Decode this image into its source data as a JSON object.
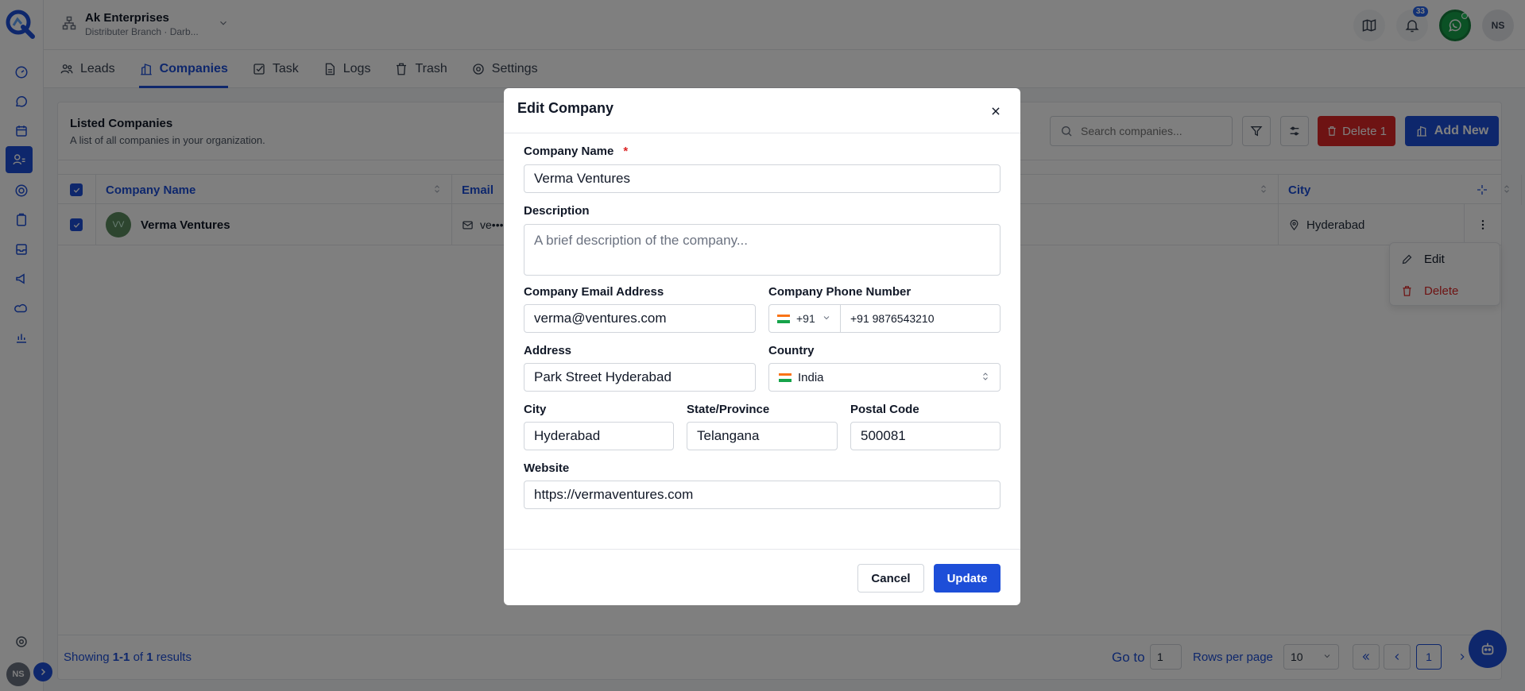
{
  "org": {
    "name": "Ak Enterprises",
    "sub": "Distributer Branch · Darb..."
  },
  "notifications": {
    "count": "33"
  },
  "user": {
    "initials": "NS"
  },
  "tabs": [
    {
      "label": "Leads",
      "icon": "users-icon"
    },
    {
      "label": "Companies",
      "icon": "building-icon"
    },
    {
      "label": "Task",
      "icon": "checkbox-icon"
    },
    {
      "label": "Logs",
      "icon": "file-icon"
    },
    {
      "label": "Trash",
      "icon": "trash-icon"
    },
    {
      "label": "Settings",
      "icon": "gear-icon"
    }
  ],
  "list": {
    "title": "Listed Companies",
    "subtitle": "A list of all companies in your organization.",
    "search_placeholder": "Search companies...",
    "delete_label": "Delete 1",
    "add_label": "Add New"
  },
  "table": {
    "columns": [
      "Company Name",
      "Email",
      "City"
    ],
    "rows": [
      {
        "initials": "VV",
        "name": "Verma Ventures",
        "email": "ve•••",
        "city": "Hyderabad"
      }
    ]
  },
  "row_menu": {
    "edit": "Edit",
    "delete": "Delete"
  },
  "footer": {
    "showing_prefix": "Showing ",
    "showing_range": "1-1",
    "showing_of": " of ",
    "showing_total": "1",
    "showing_suffix": " results",
    "goto_label": "Go to",
    "goto_value": "1",
    "rows_label": "Rows per page",
    "rows_value": "10",
    "page": "1"
  },
  "modal": {
    "title": "Edit Company",
    "company_name_label": "Company Name",
    "required_mark": "*",
    "company_name": "Verma Ventures",
    "description_label": "Description",
    "description_placeholder": "A brief description of the company...",
    "email_label": "Company Email Address",
    "email": "verma@ventures.com",
    "phone_label": "Company Phone Number",
    "phone_code": "+91",
    "phone": "+91 9876543210",
    "address_label": "Address",
    "address": "Park Street Hyderabad",
    "country_label": "Country",
    "country": "India",
    "city_label": "City",
    "city": "Hyderabad",
    "state_label": "State/Province",
    "state": "Telangana",
    "postal_label": "Postal Code",
    "postal": "500081",
    "website_label": "Website",
    "website": "https://vermaventures.com",
    "cancel_label": "Cancel",
    "update_label": "Update"
  },
  "colors": {
    "accent": "#1d4ed8",
    "danger": "#dc2626",
    "whatsapp": "#16a34a"
  }
}
